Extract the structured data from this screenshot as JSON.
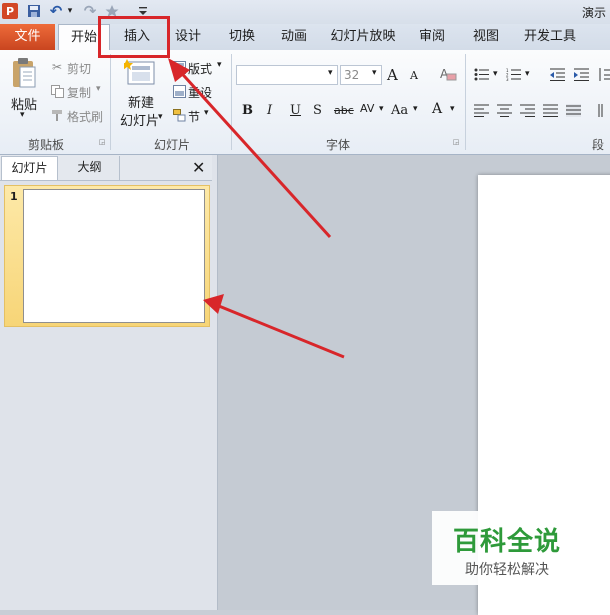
{
  "app": {
    "icon_letter": "P",
    "title": "演示"
  },
  "qat": {
    "undo": "↶",
    "redo": "↷",
    "more": "▾"
  },
  "tabs": [
    "文件",
    "开始",
    "插入",
    "设计",
    "切换",
    "动画",
    "幻灯片放映",
    "审阅",
    "视图",
    "开发工具"
  ],
  "ribbon": {
    "clipboard": {
      "paste": "粘贴",
      "cut": "剪切",
      "copy": "复制",
      "format_painter": "格式刷",
      "group_label": "剪贴板"
    },
    "slides": {
      "new_line1": "新建",
      "new_line2": "幻灯片",
      "layout": "版式",
      "reset": "重设",
      "section": "节",
      "group_label": "幻灯片"
    },
    "font": {
      "font_size": "32",
      "group_label": "字体",
      "bold": "B",
      "italic": "I",
      "underline": "U",
      "shadow": "S",
      "strike": "abc",
      "spacing": "AV",
      "case": "Aa",
      "color": "A",
      "grow": "A",
      "shrink": "A"
    },
    "paragraph": {
      "group_label": "段落"
    }
  },
  "panel": {
    "tab_slides": "幻灯片",
    "tab_outline": "大纲",
    "close": "✕",
    "slide_number": "1"
  },
  "watermark": {
    "title": "百科全说",
    "subtitle": "助你轻松解决"
  },
  "colors": {
    "accent_red": "#d8262a",
    "file_tab": "#d24726",
    "watermark_green": "#2e9a3a"
  }
}
